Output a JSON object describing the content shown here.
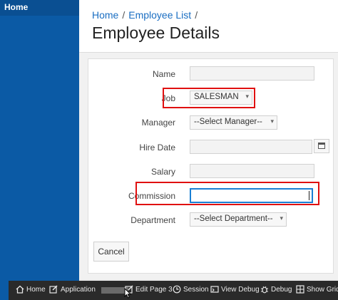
{
  "sidebar": {
    "home_label": "Home"
  },
  "breadcrumb": {
    "items": [
      "Home",
      "Employee List"
    ],
    "separator": "/"
  },
  "page": {
    "title": "Employee Details"
  },
  "form": {
    "name_label": "Name",
    "job_label": "Job",
    "job_value": "SALESMAN",
    "manager_label": "Manager",
    "manager_value": "--Select Manager--",
    "hire_date_label": "Hire Date",
    "salary_label": "Salary",
    "commission_label": "Commission",
    "department_label": "Department",
    "department_value": "--Select Department--",
    "cancel_label": "Cancel"
  },
  "devbar": {
    "home": "Home",
    "application": "Application",
    "edit_page": "Edit Page 3",
    "session": "Session",
    "view_debug": "View Debug",
    "debug": "Debug",
    "show_grid": "Show Grid"
  },
  "colors": {
    "sidebar": "#0b5aa5",
    "link": "#1a6ec2",
    "highlight": "#e01010",
    "focus": "#1a7fd4"
  }
}
